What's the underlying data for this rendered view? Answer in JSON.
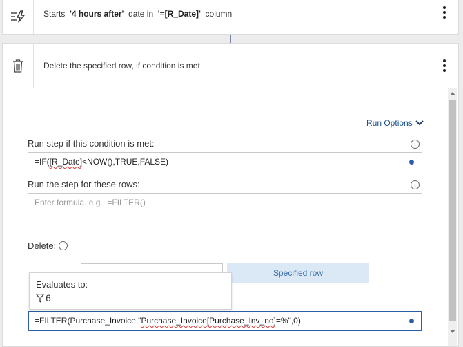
{
  "trigger": {
    "prefix": "Starts",
    "offset": "'4 hours after'",
    "middle": "date in",
    "column": "'=[R_Date]'",
    "suffix": "column"
  },
  "step": {
    "title": "Delete the specified row, if condition is met"
  },
  "run_options": {
    "label": "Run Options"
  },
  "condition": {
    "label": "Run step if this condition is met:",
    "value_prefix": "=IF(",
    "value_squiggle": "[R_Date]",
    "value_suffix": "<NOW(),TRUE,FALSE)"
  },
  "rows": {
    "label": "Run the step for these rows:",
    "placeholder": "Enter formula. e.g., =FILTER()"
  },
  "delete": {
    "label": "Delete:",
    "option_right": "Specified row"
  },
  "tooltip": {
    "title": "Evaluates to:",
    "value": "6"
  },
  "formula": {
    "part1": "=FILTER(Purchase_Invoice,\"",
    "squiggle": "Purchase_Invoice[Purchase_Inv_no]",
    "part2": "=%\",0)"
  },
  "icons": {
    "trigger": "lightning-list-icon",
    "step": "trash-icon",
    "menu": "kebab-menu-icon",
    "info": "info-icon",
    "chevron": "chevron-down-icon",
    "filter": "filter-icon"
  },
  "colors": {
    "accent": "#2d5da8",
    "link": "#1a4f8c",
    "toggle_selected_bg": "#dbe9f7"
  }
}
